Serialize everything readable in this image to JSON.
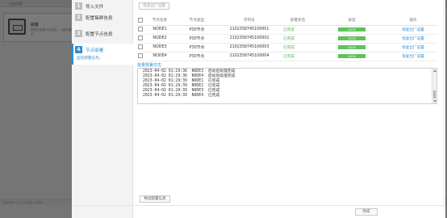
{
  "background": {
    "window_title": "任务列表",
    "card_title": "部署",
    "card_desc": "帮助您配置节点信息，一键部署节点",
    "footer_text": "版权所有 © 2023 保留一切权利"
  },
  "wizard": {
    "steps": [
      {
        "num": "1",
        "label": "导入文件"
      },
      {
        "num": "2",
        "label": "配置集群信息"
      },
      {
        "num": "3",
        "label": "配置节点信息"
      },
      {
        "num": "4",
        "label": "节点部署",
        "sub": "监控部署任务。"
      }
    ],
    "top_button": "批量出厂设置",
    "table": {
      "headers": [
        "节点名称",
        "节点类型",
        "序列号",
        "部署状态",
        "进度",
        "操作"
      ],
      "rows": [
        {
          "name": "NODE1",
          "type": "P30节点",
          "serial": "2102358745100001",
          "status": "已完成",
          "progress": "100%",
          "action": "恢复出厂设置"
        },
        {
          "name": "NODE2",
          "type": "P30节点",
          "serial": "2102358745100002",
          "status": "已完成",
          "progress": "100%",
          "action": "恢复出厂设置"
        },
        {
          "name": "NODE3",
          "type": "P30节点",
          "serial": "2102358745100003",
          "status": "已完成",
          "progress": "100%",
          "action": "恢复出厂设置"
        },
        {
          "name": "NODE4",
          "type": "P30节点",
          "serial": "2102358745100004",
          "status": "已完成",
          "progress": "100%",
          "action": "恢复出厂设置"
        }
      ]
    },
    "log": {
      "title": "批量部署日志",
      "lines": [
        "2023-04-02 01:29:36  NODE3  启动后处理完成",
        "2023-04-02 01:29:36  NODE4  启动后处理完成",
        "2023-04-02 01:29:39  NODE1  已完成",
        "2023-04-02 01:29:39  NODE2  已完成",
        "2023-04-02 01:29:39  NODE3  已完成",
        "2023-04-02 01:29:39  NODE4  已完成"
      ]
    },
    "export_button": "导出配置信息",
    "finish_button": "完成"
  }
}
